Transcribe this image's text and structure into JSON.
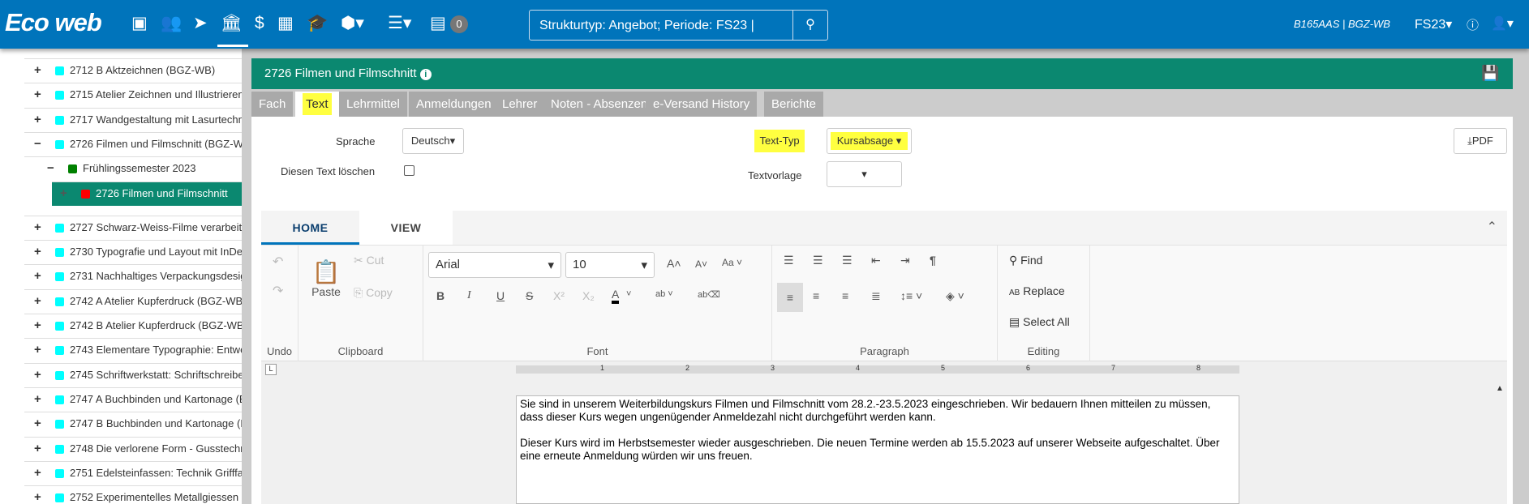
{
  "app": {
    "logo": "Eco web",
    "notification_count": "0",
    "search_value": "Strukturtyp: Angebot; Periode: FS23 |",
    "user": "B165AAS | BGZ-WB",
    "period": "FS23",
    "colors": {
      "header": "#0074bb",
      "title_bar": "#0b8870",
      "highlight": "#ffff40"
    }
  },
  "nav_icons": [
    "address-card-icon",
    "users-icon",
    "paper-plane-icon",
    "institution-icon",
    "dollar-icon",
    "calendar-icon",
    "graduation-cap-icon",
    "cubes-icon",
    "list-icon",
    "server-icon"
  ],
  "tree": [
    {
      "label": "2712 B Aktzeichnen (BGZ-WB)",
      "toggle": "+",
      "color": "#00ffff"
    },
    {
      "label": "2715 Atelier Zeichnen und Illustrieren",
      "toggle": "+",
      "color": "#00ffff"
    },
    {
      "label": "2717 Wandgestaltung mit Lasurtechn",
      "toggle": "+",
      "color": "#00ffff"
    },
    {
      "label": "2726 Filmen und Filmschnitt (BGZ-W",
      "toggle": "−",
      "color": "#00ffff"
    },
    {
      "label": "Frühlingssemester 2023",
      "toggle": "−",
      "color": "#008000"
    },
    {
      "label": "2726 Filmen und Filmschnitt",
      "toggle": "+",
      "color": "#ff0000",
      "selected": true
    },
    {
      "label": "2727 Schwarz-Weiss-Filme verarbeite",
      "toggle": "+",
      "color": "#00ffff"
    },
    {
      "label": "2730 Typografie und Layout mit InDes",
      "toggle": "+",
      "color": "#00ffff"
    },
    {
      "label": "2731 Nachhaltiges Verpackungsdesig",
      "toggle": "+",
      "color": "#00ffff"
    },
    {
      "label": "2742 A Atelier Kupferdruck (BGZ-WB",
      "toggle": "+",
      "color": "#00ffff"
    },
    {
      "label": "2742 B Atelier Kupferdruck (BGZ-WB",
      "toggle": "+",
      "color": "#00ffff"
    },
    {
      "label": "2743 Elementare Typographie: Entwe",
      "toggle": "+",
      "color": "#00ffff"
    },
    {
      "label": "2745 Schriftwerkstatt: Schriftschreibe",
      "toggle": "+",
      "color": "#00ffff"
    },
    {
      "label": "2747 A Buchbinden und Kartonage (E",
      "toggle": "+",
      "color": "#00ffff"
    },
    {
      "label": "2747 B Buchbinden und Kartonage (E",
      "toggle": "+",
      "color": "#00ffff"
    },
    {
      "label": "2748 Die verlorene Form - Gusstechn",
      "toggle": "+",
      "color": "#00ffff"
    },
    {
      "label": "2751 Edelsteinfassen: Technik Grifffa",
      "toggle": "+",
      "color": "#00ffff"
    },
    {
      "label": "2752 Experimentelles Metallgiessen",
      "toggle": "+",
      "color": "#00ffff"
    }
  ],
  "panel": {
    "title": "2726 Filmen und Filmschnitt",
    "tabs": [
      "Fach",
      "Text",
      "Lehrmittel",
      "Anmeldungen",
      "Lehrer",
      "Noten - Absenzen",
      "e-Versand History",
      "Berichte"
    ],
    "active_tab": "Text",
    "form": {
      "sprache_label": "Sprache",
      "sprache_value": "Deutsch",
      "delete_label": "Diesen Text löschen",
      "texttyp_label": "Text-Typ",
      "texttyp_value": "Kursabsage",
      "textvorlage_label": "Textvorlage",
      "textvorlage_value": "",
      "pdf_label": "PDF"
    }
  },
  "editor": {
    "tabs": [
      "HOME",
      "VIEW"
    ],
    "active_tab": "HOME",
    "ribbon": {
      "undo": "Undo",
      "clipboard": "Clipboard",
      "paste": "Paste",
      "cut": "Cut",
      "copy": "Copy",
      "font": "Font",
      "font_name": "Arial",
      "font_size": "10",
      "paragraph": "Paragraph",
      "editing": "Editing",
      "find": "Find",
      "replace": "Replace",
      "select_all": "Select All"
    },
    "ruler": [
      "1",
      "2",
      "3",
      "4",
      "5",
      "6",
      "7",
      "8"
    ],
    "paragraphs": [
      "Sie sind in unserem Weiterbildungskurs Filmen und Filmschnitt vom 28.2.-23.5.2023 eingeschrieben. Wir bedauern Ihnen mitteilen zu müssen, dass dieser Kurs wegen ungenügender Anmeldezahl nicht durchgeführt werden kann.",
      "Dieser Kurs wird im Herbstsemester wieder ausgeschrieben. Die neuen Termine werden ab 15.5.2023 auf unserer Webseite aufgeschaltet. Über eine erneute Anmeldung würden wir uns freuen."
    ]
  }
}
